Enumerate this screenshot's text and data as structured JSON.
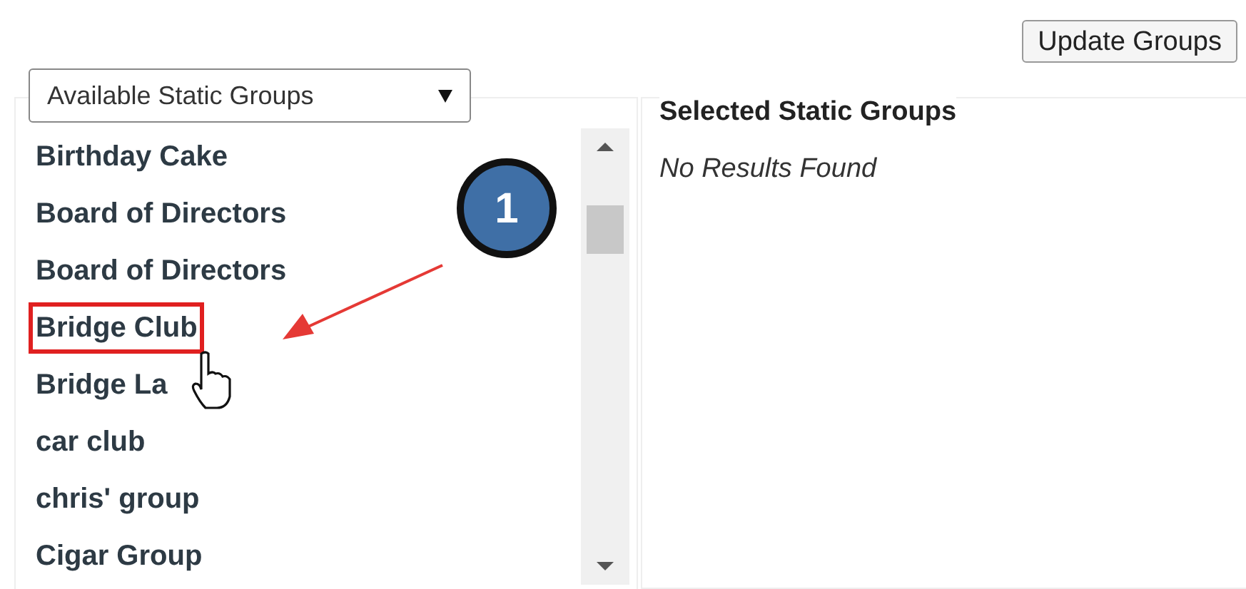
{
  "update_button": "Update Groups",
  "available": {
    "dropdown": "Available Static Groups",
    "items": [
      {
        "label": "Birthday Cake",
        "highlighted": false
      },
      {
        "label": "Board of Directors",
        "highlighted": false
      },
      {
        "label": "Board of Directors",
        "highlighted": false
      },
      {
        "label": "Bridge Club",
        "highlighted": true
      },
      {
        "label": "Bridge La",
        "highlighted": false
      },
      {
        "label": "car club",
        "highlighted": false
      },
      {
        "label": "chris' group",
        "highlighted": false
      },
      {
        "label": "Cigar Group",
        "highlighted": false
      }
    ]
  },
  "selected": {
    "title": "Selected Static Groups",
    "empty_text": "No Results Found"
  },
  "callout": "1"
}
